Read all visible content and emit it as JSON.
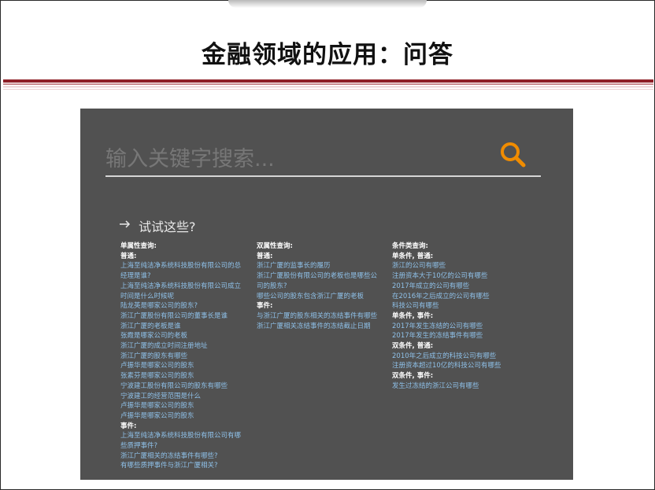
{
  "slide": {
    "title": "金融领域的应用：问答"
  },
  "search": {
    "placeholder": "输入关键字搜索...",
    "try_label": "试试这些?"
  },
  "colors": {
    "panel_bg": "#515151",
    "search_icon": "#f08c00",
    "link": "#8ec0e8",
    "heading": "#ffffff",
    "accent_rule": "#8e1f26"
  },
  "columns": [
    {
      "lines": [
        {
          "type": "head",
          "text": "单属性查询:"
        },
        {
          "type": "head",
          "text": "普通:"
        },
        {
          "type": "link",
          "text": "上海至纯洁净系统科技股份有限公司的总"
        },
        {
          "type": "link",
          "text": "经理是谁?"
        },
        {
          "type": "link",
          "text": "上海至纯洁净系统科技股份有限公司成立"
        },
        {
          "type": "link",
          "text": "时间是什么时候呢"
        },
        {
          "type": "link",
          "text": "陆龙英是哪家公司的股东?"
        },
        {
          "type": "link",
          "text": "浙江广厦股份有限公司的董事长是谁"
        },
        {
          "type": "link",
          "text": "浙江广厦的老板是谁"
        },
        {
          "type": "link",
          "text": "张霞是哪家公司的老板"
        },
        {
          "type": "link",
          "text": "浙江广厦的成立时间注册地址"
        },
        {
          "type": "link",
          "text": "浙江广厦的股东有哪些"
        },
        {
          "type": "link",
          "text": "卢振华是哪家公司的股东"
        },
        {
          "type": "link",
          "text": "张素芬是哪家公司的股东"
        },
        {
          "type": "link",
          "text": "宁波建工股份有限公司的股东有哪些"
        },
        {
          "type": "link",
          "text": "宁波建工的经营范围是什么"
        },
        {
          "type": "link",
          "text": "卢振华是哪家公司的股东"
        },
        {
          "type": "link",
          "text": "卢振华是哪家公司的股东"
        },
        {
          "type": "head",
          "text": "事件:"
        },
        {
          "type": "link",
          "text": "上海至纯洁净系统科技股份有限公司有哪"
        },
        {
          "type": "link",
          "text": "些质押事件?"
        },
        {
          "type": "link",
          "text": "浙江广厦相关的冻结事件有哪些?"
        },
        {
          "type": "link",
          "text": "有哪些质押事件与浙江广厦相关?"
        }
      ]
    },
    {
      "lines": [
        {
          "type": "head",
          "text": "双属性查询:"
        },
        {
          "type": "head",
          "text": "普通:"
        },
        {
          "type": "link",
          "text": "浙江广厦的监事长的履历"
        },
        {
          "type": "link",
          "text": "浙江广厦股份有限公司的老板也是哪些公"
        },
        {
          "type": "link",
          "text": "司的股东?"
        },
        {
          "type": "link",
          "text": "哪些公司的股东包含浙江广厦的老板"
        },
        {
          "type": "head",
          "text": "事件:"
        },
        {
          "type": "link",
          "text": "与浙江广厦的股东相关的冻结事件有哪些"
        },
        {
          "type": "link",
          "text": "浙江广厦相关冻结事件的冻结截止日期"
        }
      ]
    },
    {
      "lines": [
        {
          "type": "head",
          "text": "条件类查询:"
        },
        {
          "type": "head",
          "text": "单条件, 普通:"
        },
        {
          "type": "link",
          "text": "浙江的公司有哪些"
        },
        {
          "type": "link",
          "text": "注册资本大于10亿的公司有哪些"
        },
        {
          "type": "link",
          "text": "2017年成立的公司有哪些"
        },
        {
          "type": "link",
          "text": "在2016年之后成立的公司有哪些"
        },
        {
          "type": "link",
          "text": "科技公司有哪些"
        },
        {
          "type": "head",
          "text": "单条件, 事件:"
        },
        {
          "type": "link",
          "text": "2017年发生冻结的公司有哪些"
        },
        {
          "type": "link",
          "text": "2017年发生的冻结事件有哪些"
        },
        {
          "type": "head",
          "text": "双条件, 普通:"
        },
        {
          "type": "link",
          "text": "2010年之后成立的科技公司有哪些"
        },
        {
          "type": "link",
          "text": "注册资本超过10亿的科技公司有哪些"
        },
        {
          "type": "head",
          "text": "双条件, 事件:"
        },
        {
          "type": "link",
          "text": "发生过冻结的浙江公司有哪些"
        }
      ]
    }
  ]
}
